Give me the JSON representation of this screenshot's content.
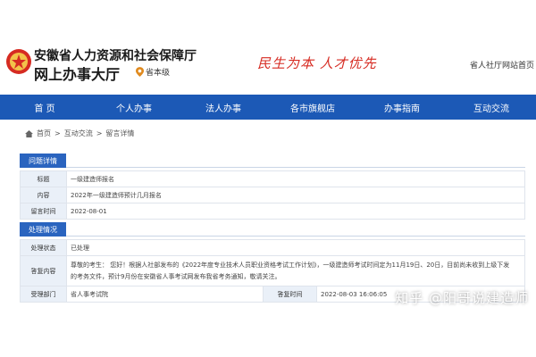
{
  "header": {
    "org_name": "安徽省人力资源和社会保障厅",
    "hall_name": "网上办事大厅",
    "level": "省本级",
    "slogan": "民生为本  人才优先",
    "top_link": "省人社厅网站首页"
  },
  "nav": {
    "items": [
      "首 页",
      "个人办事",
      "法人办事",
      "各市旗舰店",
      "办事指南",
      "互动交流"
    ]
  },
  "breadcrumb": {
    "items": [
      "首页",
      ">",
      "互动交流",
      ">",
      "留言详情"
    ]
  },
  "question": {
    "section_title": "问题详情",
    "rows": [
      {
        "key": "标题",
        "value": "一级建造师报名"
      },
      {
        "key": "内容",
        "value": "2022年一级建造师预计几月报名"
      },
      {
        "key": "留言时间",
        "value": "2022-08-01"
      }
    ]
  },
  "handling": {
    "section_title": "处理情况",
    "status_key": "处理状态",
    "status_value": "已处理",
    "reply_key": "答复内容",
    "reply_line1": "尊敬的考生：  您好！根据人社部发布的《2022年度专业技术人员职业资格考试工作计划》，一级建造师考试时间定为11月19日、20日，目前尚未收到上级下发",
    "reply_line2": "的考务文件，预计9月份在安徽省人事考试网发布我省考务通知，敬请关注。",
    "dept_key": "受理部门",
    "dept_value": "省人事考试院",
    "time_key": "答复时间",
    "time_value": "2022-08-03 16:06:05"
  },
  "watermark": "知乎 @阳哥说建造师",
  "colors": {
    "nav_blue": "#1c59b6",
    "tab_blue": "#2a64bf",
    "slogan_red": "#d62b22"
  }
}
